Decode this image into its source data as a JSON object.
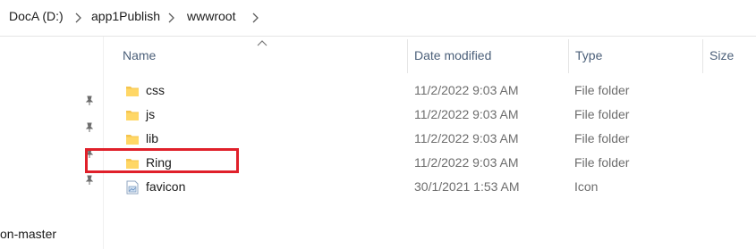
{
  "breadcrumb": {
    "items": [
      "DocA (D:)",
      "app1Publish",
      "wwwroot"
    ]
  },
  "columns": {
    "name": "Name",
    "date_modified": "Date modified",
    "type": "Type",
    "size": "Size"
  },
  "navigation": {
    "visible_item": "on-master"
  },
  "files": [
    {
      "name": "css",
      "date": "11/2/2022 9:03 AM",
      "type": "File folder",
      "icon": "folder-icon"
    },
    {
      "name": "js",
      "date": "11/2/2022 9:03 AM",
      "type": "File folder",
      "icon": "folder-icon"
    },
    {
      "name": "lib",
      "date": "11/2/2022 9:03 AM",
      "type": "File folder",
      "icon": "folder-icon"
    },
    {
      "name": "Ring",
      "date": "11/2/2022 9:03 AM",
      "type": "File folder",
      "icon": "folder-icon"
    },
    {
      "name": "favicon",
      "date": "30/1/2021 1:53 AM",
      "type": "Icon",
      "icon": "ico-file-icon"
    }
  ],
  "colors": {
    "highlight": "#e0202a",
    "folder": "#f5c44e"
  }
}
